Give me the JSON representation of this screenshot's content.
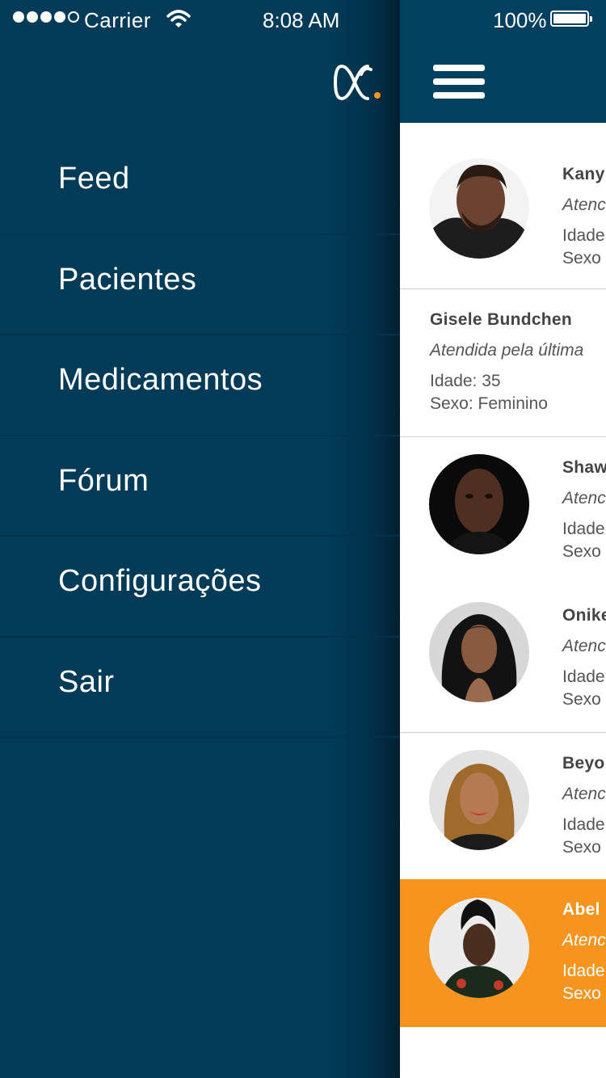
{
  "status_bar": {
    "carrier": "Carrier",
    "time": "8:08 AM",
    "battery": "100%"
  },
  "menu": {
    "items": [
      {
        "label": "Feed"
      },
      {
        "label": "Pacientes"
      },
      {
        "label": "Medicamentos"
      },
      {
        "label": "Fórum"
      },
      {
        "label": "Configurações"
      },
      {
        "label": "Sair"
      }
    ]
  },
  "patients": [
    {
      "name": "Kany",
      "last": "Atenc",
      "age": "Idade",
      "sex": "Sexo"
    },
    {
      "name": "Gisele Bundchen",
      "last": "Atendida pela última",
      "age": "Idade: 35",
      "sex": "Sexo: Feminino"
    },
    {
      "name": "Shaw",
      "last": "Atenc",
      "age": "Idade",
      "sex": "Sexo"
    },
    {
      "name": "Onike",
      "last": "Atenc",
      "age": "Idade",
      "sex": "Sexo"
    },
    {
      "name": "Beyo",
      "last": "Atenc",
      "age": "Idade",
      "sex": "Sexo"
    },
    {
      "name": "Abel",
      "last": "Atenc",
      "age": "Idade",
      "sex": "Sexo"
    }
  ],
  "colors": {
    "drawer_bg": "#013b58",
    "header_bg": "#01405e",
    "accent_orange": "#f7941d",
    "text_white": "#ffffff"
  },
  "icons": {
    "menu": "hamburger-icon",
    "logo": "app-logo",
    "wifi": "wifi-icon",
    "battery": "battery-icon",
    "signal": "signal-dots-icon"
  }
}
